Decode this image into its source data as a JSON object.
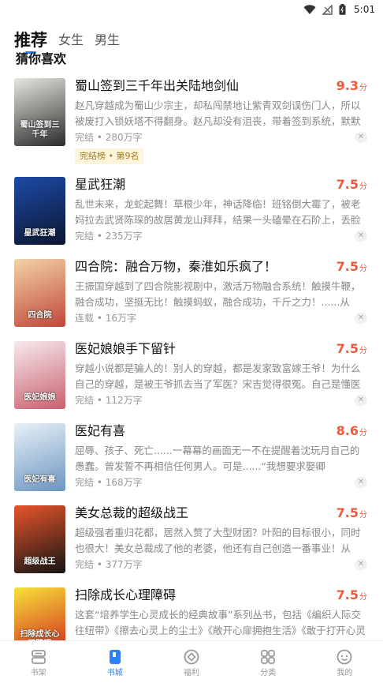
{
  "status_bar": {
    "time": "5:01",
    "icons": [
      "wifi-icon",
      "signal-icon",
      "battery-icon"
    ]
  },
  "top_tabs": [
    {
      "label": "推荐",
      "active": true
    },
    {
      "label": "女生",
      "active": false
    },
    {
      "label": "男生",
      "active": false
    }
  ],
  "section": {
    "title": "猜你喜欢"
  },
  "books": [
    {
      "title": "蜀山签到三千年出关陆地剑仙",
      "score": "9.3",
      "score_unit": "分",
      "desc": "赵凡穿越成为蜀山少宗主，却私闯禁地让紫青双剑误伤门人，所以被废打入锁妖塔不得翻身。赵凡却没有沮丧，带着签到系统，默默签到三千年",
      "meta": "完结 • 280万字",
      "tag": "完结榜 • 第9名",
      "cover_text": "蜀山签到三千年",
      "cover_colors": [
        "#e8e6e1",
        "#2c2b2a"
      ]
    },
    {
      "title": "星武狂潮",
      "score": "7.5",
      "score_unit": "分",
      "desc": "乱世末来，龙蛇起舞！草根少年，神话降临！班铭倒大霉了，被老妈拉去武贤陈琛的故居黄龙山拜拜，结果一头磕晕在石阶上，丢脸丢到",
      "meta": "完结 • 235万字",
      "tag": "",
      "cover_text": "星武狂潮",
      "cover_colors": [
        "#1d4aa8",
        "#0b1630"
      ]
    },
    {
      "title": "四合院：融合万物，秦淮如乐疯了！",
      "score": "7.5",
      "score_unit": "分",
      "desc": "王振国穿越到了四合院影视剧中，激活万物融合系统！触摸牛鞭，融合成功，坚挺无比！触摸蚂蚁，融合成功，千斤之力！......从此，",
      "meta": "连载 • 16万字",
      "tag": "",
      "cover_text": "四合院",
      "cover_colors": [
        "#f3d3a6",
        "#c0473a"
      ]
    },
    {
      "title": "医妃娘娘手下留针",
      "score": "7.5",
      "score_unit": "分",
      "desc": "穿越小说都是骗人的！别人的穿越，都是发家致富嫁王爷！为什么自己的穿越，是被王爷抓去当了军医？宋吉觉得很冤。自己是懂医术没错",
      "meta": "完结 • 112万字",
      "tag": "",
      "cover_text": "医妃娘娘",
      "cover_colors": [
        "#f7eaee",
        "#c9606e"
      ]
    },
    {
      "title": "医妃有喜",
      "score": "8.6",
      "score_unit": "分",
      "desc": "屈辱、孩子、死亡......一幕幕的画面无一不在提醒着沈玩月自己的愚蠢。曾发誓不再相信任何男人。可是......“我想要求娶卿卿......”半路杀出",
      "meta": "完结 • 168万字",
      "tag": "",
      "cover_text": "医妃有喜",
      "cover_colors": [
        "#e9f1f7",
        "#6b95c2"
      ]
    },
    {
      "title": "美女总裁的超级战王",
      "score": "7.5",
      "score_unit": "分",
      "desc": "超级强者重归花都，居然入赘了大型财团？叶阳的目标很小，同时也很大！美女总裁成了他的老婆，他还有自己创造一番事业！从此，花都",
      "meta": "完结 • 377万字",
      "tag": "",
      "cover_text": "超级战王",
      "cover_colors": [
        "#e8552a",
        "#141414"
      ]
    },
    {
      "title": "扫除成长心理障碍",
      "score": "7.5",
      "score_unit": "分",
      "desc": "这套“培养学生心灵成长的经典故事”系列丛书，包括《编织人际交往纽带》《擦去心灵上的尘土》《敞开心扉拥抱生活》《敢于打开心灵的",
      "meta": "完结 • 6万字",
      "tag": "",
      "cover_text": "扫除成长心理障碍",
      "cover_colors": [
        "#f6e23a",
        "#d2231c"
      ]
    }
  ],
  "bottom_tabs": [
    {
      "label": "书架",
      "icon": "bookshelf-icon",
      "active": false
    },
    {
      "label": "书城",
      "icon": "bookstore-icon",
      "active": true
    },
    {
      "label": "福利",
      "icon": "welfare-icon",
      "active": false
    },
    {
      "label": "分类",
      "icon": "category-icon",
      "active": false
    },
    {
      "label": "我的",
      "icon": "profile-icon",
      "active": false
    }
  ],
  "colors": {
    "accent": "#2f7ff7",
    "score": "#f05a3c",
    "tag_bg": "#fdf4dc",
    "tag_text": "#a57a20"
  }
}
